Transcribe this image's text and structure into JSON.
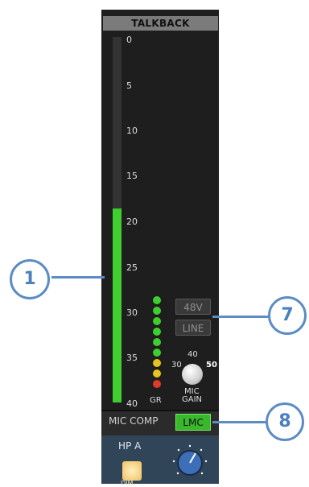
{
  "panel": {
    "title": "TALKBACK",
    "meter_level_fraction": 0.53,
    "meter_color": "#3ecf2f",
    "scale": [
      "0",
      "5",
      "10",
      "15",
      "20",
      "25",
      "30",
      "35",
      "40"
    ],
    "gr_label": "GR",
    "gr_leds": [
      "#3ecf2f",
      "#3ecf2f",
      "#3ecf2f",
      "#3ecf2f",
      "#3ecf2f",
      "#3ecf2f",
      "#e6c41d",
      "#e6c41d",
      "#e23a2a"
    ],
    "btn_48v": "48V",
    "btn_line": "LINE",
    "gain_30": "30",
    "gain_40": "40",
    "gain_50": "50",
    "gain_label1": "MIC",
    "gain_label2": "GAIN",
    "mic_comp_label": "MIC COMP",
    "lmc_label": "LMC",
    "hp_title": "HP A",
    "hp_sub": "DIM"
  },
  "callouts": {
    "c1": "1",
    "c7": "7",
    "c8": "8"
  }
}
